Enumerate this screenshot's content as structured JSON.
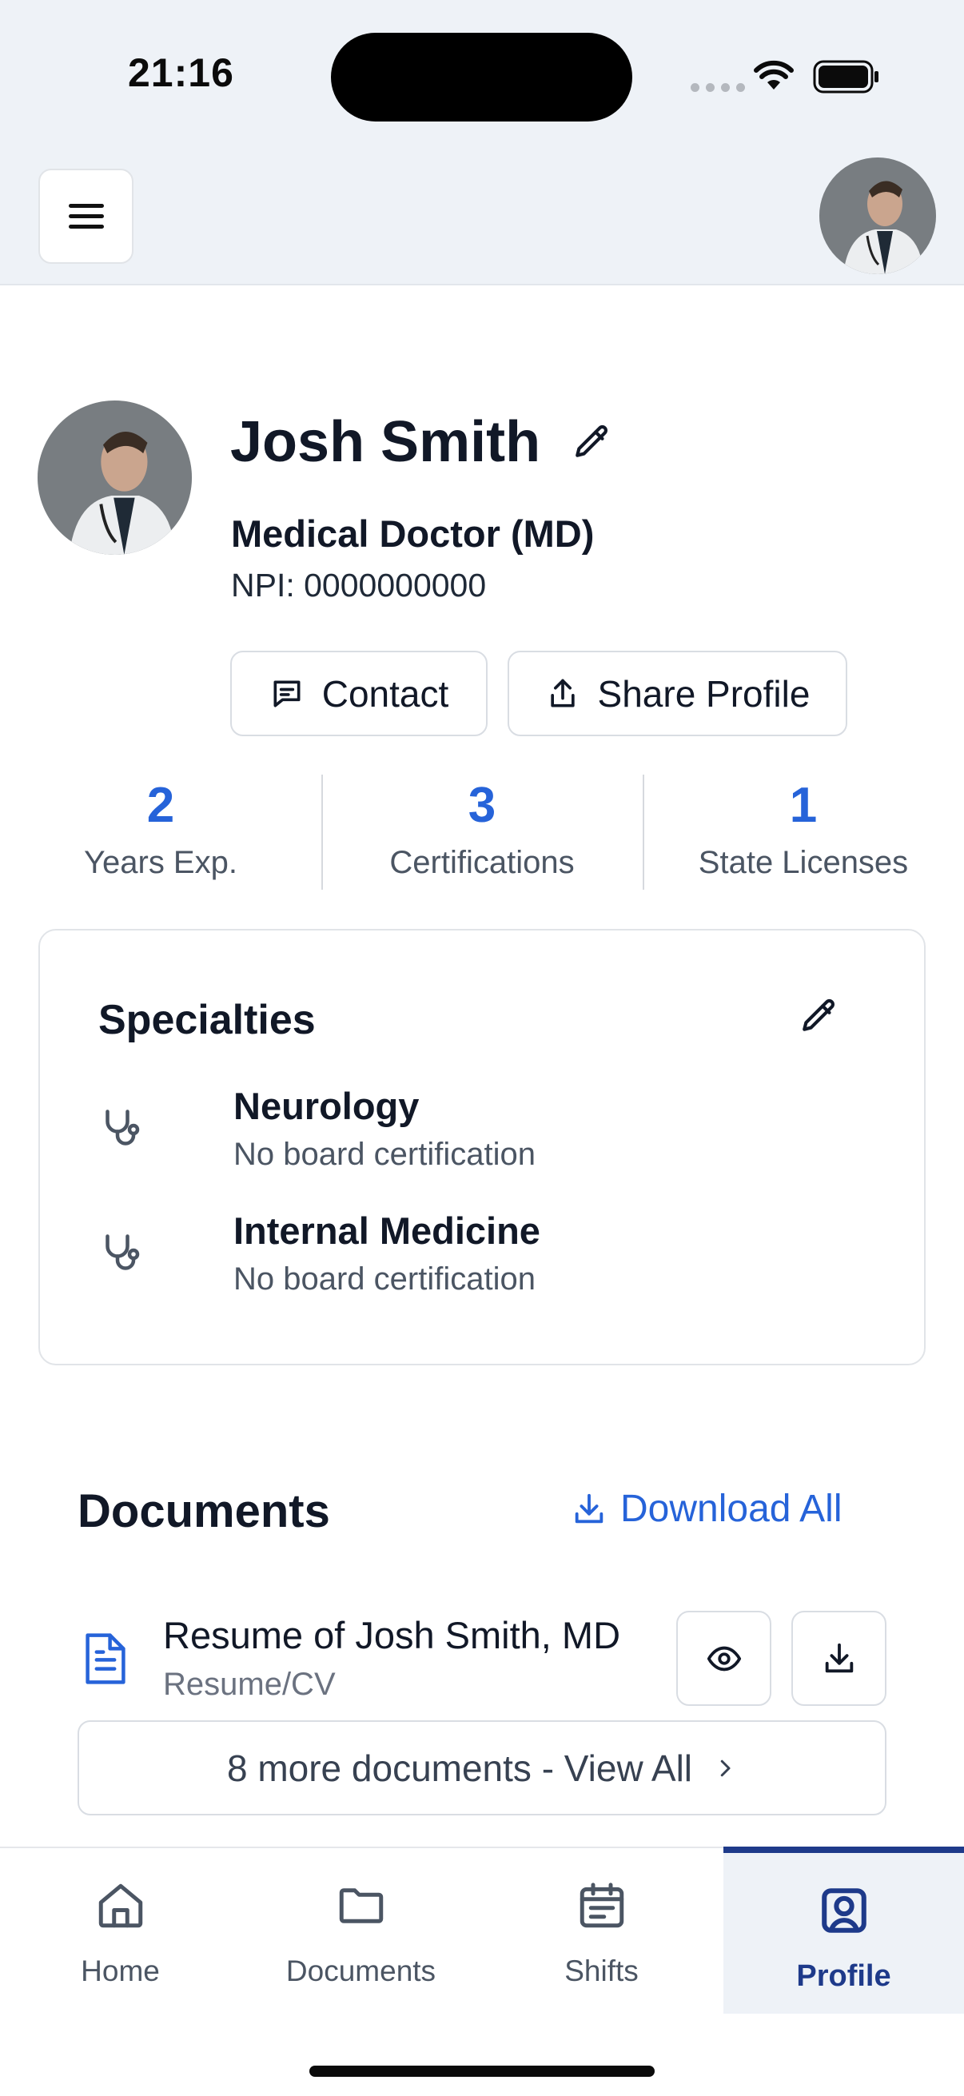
{
  "status_bar": {
    "time": "21:16"
  },
  "profile": {
    "name": "Josh Smith",
    "role": "Medical Doctor (MD)",
    "npi": "NPI: 0000000000",
    "contact_label": "Contact",
    "share_label": "Share Profile"
  },
  "stats": [
    {
      "value": "2",
      "label": "Years Exp."
    },
    {
      "value": "3",
      "label": "Certifications"
    },
    {
      "value": "1",
      "label": "State Licenses"
    }
  ],
  "specialties": {
    "title": "Specialties",
    "items": [
      {
        "name": "Neurology",
        "note": "No board certification"
      },
      {
        "name": "Internal Medicine",
        "note": "No board certification"
      }
    ]
  },
  "documents": {
    "title": "Documents",
    "download_all_label": "Download All",
    "items": [
      {
        "name": "Resume of Josh Smith, MD",
        "type": "Resume/CV"
      }
    ],
    "more_label": "8 more documents - View All"
  },
  "bottom_nav": {
    "items": [
      {
        "label": "Home",
        "icon": "home-icon"
      },
      {
        "label": "Documents",
        "icon": "folder-icon"
      },
      {
        "label": "Shifts",
        "icon": "calendar-icon"
      },
      {
        "label": "Profile",
        "icon": "profile-icon",
        "active": true
      }
    ]
  },
  "colors": {
    "accent": "#2663d9",
    "nav_active": "#1e3a8a",
    "header_bg": "#eef2f7"
  }
}
